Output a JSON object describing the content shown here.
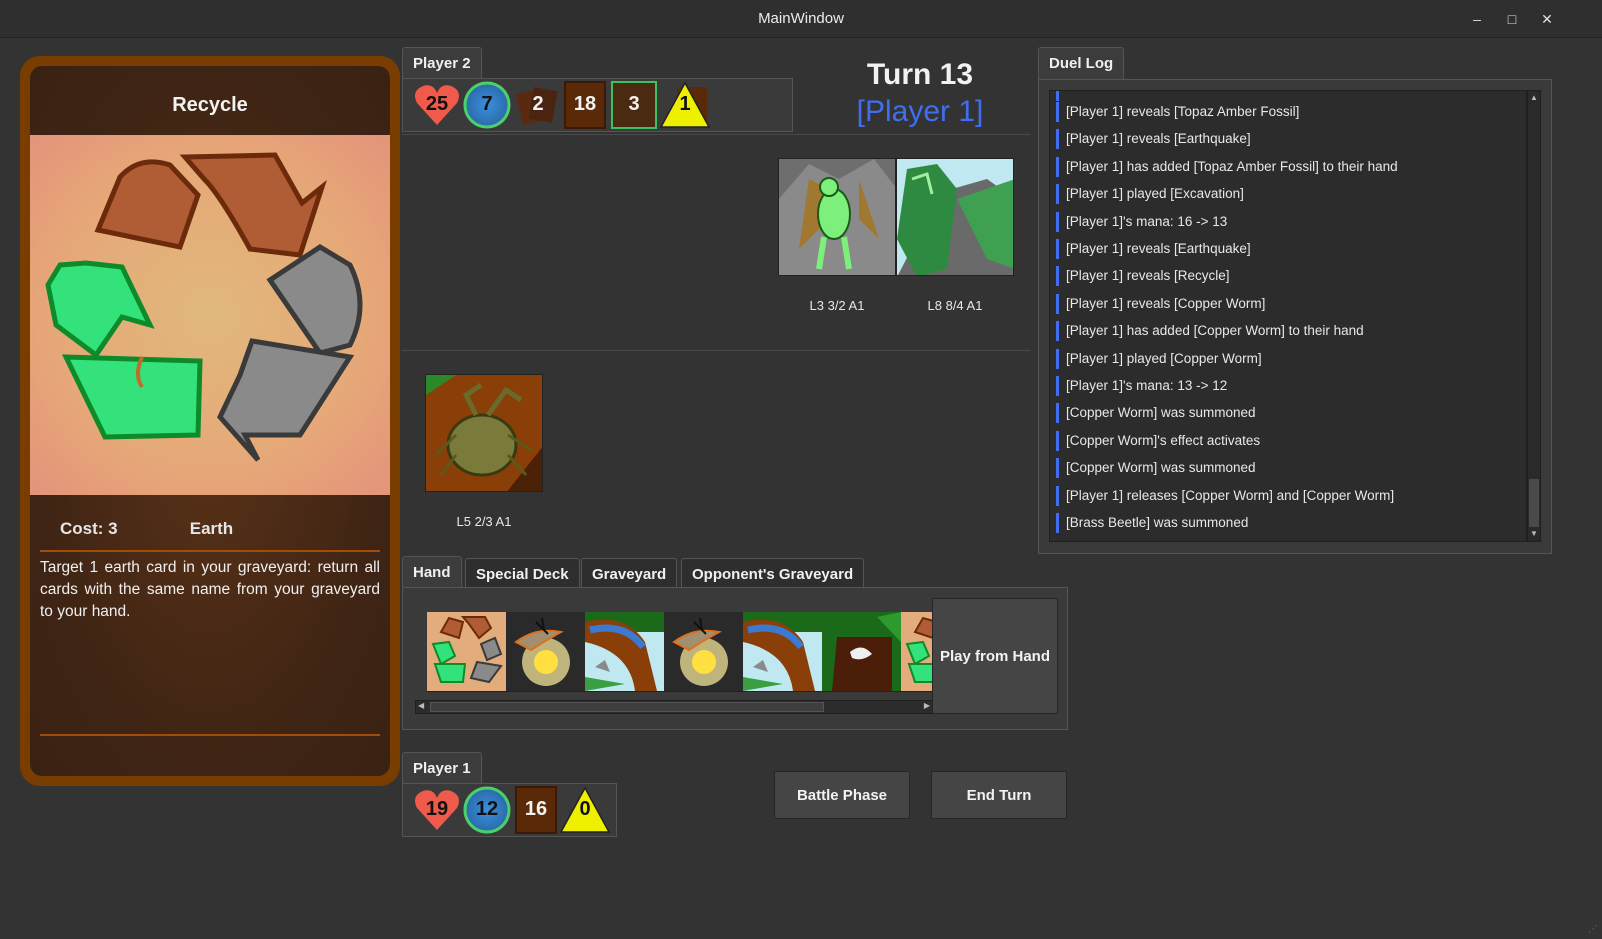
{
  "window": {
    "title": "MainWindow",
    "minimize": "–",
    "maximize": "□",
    "close": "✕"
  },
  "card_preview": {
    "name": "Recycle",
    "cost": "Cost: 3",
    "attribute": "Earth",
    "text": "Target 1 earth card in your graveyard: return all cards with the same name from your graveyard to your hand."
  },
  "player2": {
    "tab": "Player 2",
    "life": "25",
    "mana": "7",
    "hand_count": "2",
    "deck_count": "18",
    "special_deck_count": "3",
    "warning_count": "1"
  },
  "turn": {
    "title": "Turn 13",
    "player": "[Player 1]"
  },
  "opponent_field": [
    {
      "label": "L3 3/2 A1"
    },
    {
      "label": "L8 8/4 A1"
    }
  ],
  "player_field": [
    {
      "label": "L5 2/3 A1"
    }
  ],
  "duel_log": {
    "tab": "Duel Log",
    "entries": [
      "[Player 1] reveals [Topaz Amber Fossil]",
      "[Player 1] reveals [Earthquake]",
      "[Player 1] has added [Topaz Amber Fossil] to their hand",
      "[Player 1] played [Excavation]",
      "[Player 1]'s mana:  16 -> 13",
      "[Player 1] reveals [Earthquake]",
      "[Player 1] reveals [Recycle]",
      "[Player 1] reveals [Copper Worm]",
      "[Player 1] has added [Copper Worm] to their hand",
      "[Player 1] played [Copper Worm]",
      "[Player 1]'s mana:  13 -> 12",
      "[Copper Worm] was summoned",
      "[Copper Worm]'s effect activates",
      "[Copper Worm] was summoned",
      "[Player 1] releases [Copper Worm] and [Copper Worm]",
      "[Brass Beetle] was summoned"
    ]
  },
  "zone_tabs": [
    "Hand",
    "Special Deck",
    "Graveyard",
    "Opponent's Graveyard"
  ],
  "hand": {
    "cards": [
      "recycle-card",
      "firefly-card",
      "worm-card",
      "firefly-card",
      "worm-card",
      "tree-card",
      "recycle-card"
    ],
    "play_button": "Play from Hand"
  },
  "player1": {
    "tab": "Player 1",
    "life": "19",
    "mana": "12",
    "deck_count": "16",
    "warning_count": "0"
  },
  "actions": {
    "battle_phase": "Battle Phase",
    "end_turn": "End Turn"
  },
  "colors": {
    "accent": "#3f6ff0",
    "card_frame": "#7a3d00",
    "heart": "#f05a4a",
    "warning": "#f0f000"
  }
}
